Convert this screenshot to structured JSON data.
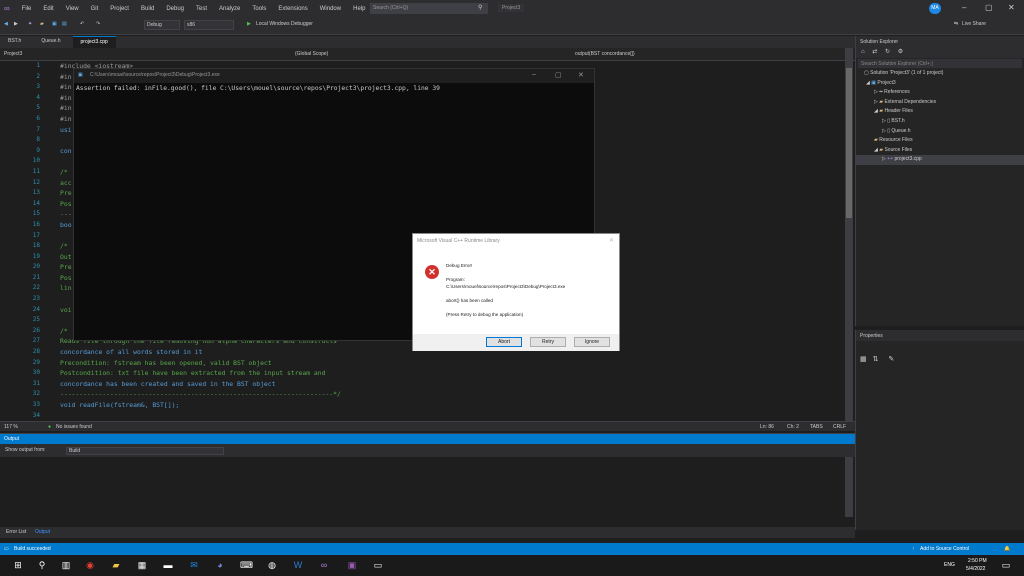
{
  "menu": [
    "File",
    "Edit",
    "View",
    "Git",
    "Project",
    "Build",
    "Debug",
    "Test",
    "Analyze",
    "Tools",
    "Extensions",
    "Window",
    "Help"
  ],
  "search_placeholder": "Search (Ctrl+Q)",
  "project_name": "Project3",
  "avatar_initials": "MA",
  "live_share": "Live Share",
  "toolbar": {
    "config": "Debug",
    "platform": "x86",
    "run_label": "Local Windows Debugger"
  },
  "tabs": [
    "BST.h",
    "Queue.h",
    "project3.cpp"
  ],
  "navbar": {
    "project": "Project3",
    "scope": "(Global Scope)",
    "member": "output(BST concordance[])"
  },
  "lines": [
    "1",
    "2",
    "3",
    "4",
    "5",
    "6",
    "7",
    "8",
    "9",
    "10",
    "11",
    "12",
    "13",
    "14",
    "15",
    "16",
    "17",
    "18",
    "19",
    "20",
    "21",
    "22",
    "23",
    "24",
    "25",
    "26",
    "27",
    "28",
    "29",
    "30",
    "31",
    "32",
    "33",
    "34"
  ],
  "code": [
    "#include <iostream>",
    "#in",
    "#in",
    "#in",
    "#in",
    "#in",
    "usi",
    "",
    "con",
    "",
    "/*",
    "acc",
    "Pre",
    "Pos",
    "---",
    "boo",
    "",
    "/*",
    "Out",
    "Pre",
    "Pos",
    "lin",
    "",
    "voi",
    "",
    "/*",
    "Reads file through the file removing non alpha characters and constructs",
    "concordance of all words stored in it",
    "Precondition: fstream has been opened, valid BST object",
    "Postcondition: txt file have been extracted from the input stream and",
    "concordance has been created and saved in the BST object",
    "-----------------------------------------------------------------------*/",
    "void readFile(fstream&, BST[]);",
    ""
  ],
  "status_editor": {
    "zoom": "117 %",
    "issues": "No issues found",
    "ln": "Ln: 86",
    "ch": "Ch: 2",
    "tabs": "TABS",
    "crlf": "CRLF"
  },
  "console": {
    "title": "C:\\Users\\mouel\\source\\repos\\Project3\\Debug\\Project3.exe",
    "text": "Assertion failed: inFile.good(), file C:\\Users\\mouel\\source\\repos\\Project3\\project3.cpp, line 39"
  },
  "dialog": {
    "title": "Microsoft Visual C++ Runtime Library",
    "heading": "Debug Error!",
    "program_label": "Program:",
    "program_path": "C:\\Users\\mouel\\source\\repos\\Project3\\Debug\\Project3.exe",
    "abort_msg": "abort() has been called",
    "hint": "(Press Retry to debug the application)",
    "buttons": {
      "abort": "Abort",
      "retry": "Retry",
      "ignore": "Ignore"
    }
  },
  "solution_explorer": {
    "title": "Solution Explorer",
    "search_placeholder": "Search Solution Explorer (Ctrl+;)",
    "items": [
      "Solution 'Project3' (1 of 1 project)",
      "Project3",
      "References",
      "External Dependencies",
      "Header Files",
      "BST.h",
      "Queue.h",
      "Resource Files",
      "Source Files",
      "project3.cpp"
    ]
  },
  "properties_title": "Properties",
  "output": {
    "title": "Output",
    "show_from_label": "Show output from:",
    "show_from_value": "Build"
  },
  "bottom_tabs": [
    "Error List",
    "Output"
  ],
  "statusbar": {
    "left": "Build succeeded",
    "right": "Add to Source Control"
  },
  "taskbar": {
    "lang": "ENG",
    "time": "2:50 PM",
    "date": "5/4/2022"
  }
}
